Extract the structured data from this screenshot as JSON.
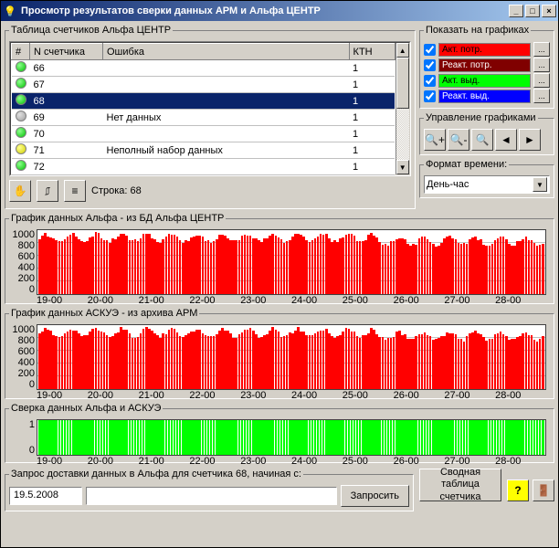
{
  "window": {
    "title": "Просмотр результатов сверки данных АРМ и Альфа ЦЕНТР"
  },
  "table": {
    "title": "Таблица счетчиков Альфа ЦЕНТР",
    "headers": {
      "status": "#",
      "counter": "N счетчика",
      "error": "Ошибка",
      "ktn": "КТН"
    },
    "rows": [
      {
        "status": "green",
        "n": "66",
        "err": "",
        "ktn": "1"
      },
      {
        "status": "green",
        "n": "67",
        "err": "",
        "ktn": "1"
      },
      {
        "status": "green",
        "n": "68",
        "err": "",
        "ktn": "1",
        "selected": true
      },
      {
        "status": "gray",
        "n": "69",
        "err": "Нет данных",
        "ktn": "1"
      },
      {
        "status": "green",
        "n": "70",
        "err": "",
        "ktn": "1"
      },
      {
        "status": "yellow",
        "n": "71",
        "err": "Неполный набор данных",
        "ktn": "1"
      },
      {
        "status": "green",
        "n": "72",
        "err": "",
        "ktn": "1"
      }
    ],
    "status_line": "Строка: 68"
  },
  "legend": {
    "title": "Показать на графиках",
    "items": [
      {
        "label": "Акт. потр.",
        "bg": "#ff0000",
        "fg": "#000000"
      },
      {
        "label": "Реакт. потр.",
        "bg": "#800000",
        "fg": "#ffffff"
      },
      {
        "label": "Акт. выд.",
        "bg": "#00ff00",
        "fg": "#000000"
      },
      {
        "label": "Реакт. выд.",
        "bg": "#0000ff",
        "fg": "#ffffff"
      }
    ]
  },
  "chart_controls": {
    "title": "Управление графиками"
  },
  "time_format": {
    "title": "Формат времени:",
    "value": "День-час"
  },
  "chart_data": [
    {
      "title": "График данных Альфа - из БД Альфа ЦЕНТР",
      "type": "bar",
      "color": "#ff0000",
      "ylim": [
        0,
        1000
      ],
      "yticks": [
        0,
        200,
        400,
        600,
        800,
        1000
      ],
      "xticks": [
        "19-00",
        "20-00",
        "21-00",
        "22-00",
        "23-00",
        "24-00",
        "25-00",
        "26-00",
        "27-00",
        "28-00"
      ],
      "approx_range": [
        750,
        950
      ],
      "approx_range_after_24": [
        780,
        860
      ]
    },
    {
      "title": "График данных АСКУЭ - из архива АРМ",
      "type": "bar",
      "color": "#ff0000",
      "ylim": [
        0,
        1000
      ],
      "yticks": [
        0,
        200,
        400,
        600,
        800,
        1000
      ],
      "xticks": [
        "19-00",
        "20-00",
        "21-00",
        "22-00",
        "23-00",
        "24-00",
        "25-00",
        "26-00",
        "27-00",
        "28-00"
      ],
      "approx_range": [
        750,
        950
      ],
      "approx_range_after_24": [
        780,
        860
      ]
    },
    {
      "title": "Сверка данных Альфа и АСКУЭ",
      "type": "bar",
      "color": "#00ff00",
      "ylim": [
        0,
        1
      ],
      "yticks": [
        0,
        1
      ],
      "xticks": [
        "19-00",
        "20-00",
        "21-00",
        "22-00",
        "23-00",
        "24-00",
        "25-00",
        "26-00",
        "27-00",
        "28-00"
      ],
      "constant_value": 1
    }
  ],
  "request": {
    "title": "Запрос доставки данных в Альфа для счетчика 68, начиная с:",
    "date": "19.5.2008",
    "button": "Запросить"
  },
  "summary_button": "Сводная таблица счетчика"
}
